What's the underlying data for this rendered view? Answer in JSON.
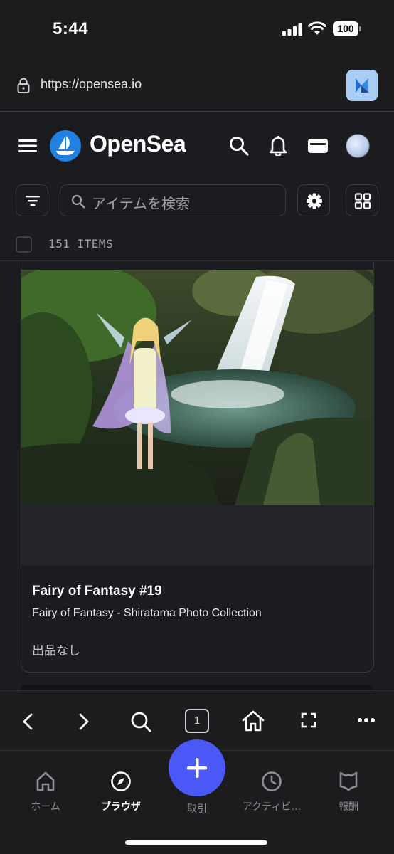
{
  "status_bar": {
    "time": "5:44",
    "battery": "100"
  },
  "browser": {
    "url": "https://opensea.io"
  },
  "opensea": {
    "logo_text": "OpenSea",
    "search_placeholder": "アイテムを検索",
    "items_count": "151 ITEMS"
  },
  "card": {
    "title": "Fairy of Fantasy #19",
    "collection": "Fairy of Fantasy - Shiratama Photo Collection",
    "status": "出品なし"
  },
  "browser_toolbar": {
    "tab_count": "1"
  },
  "tab_bar": {
    "tabs": [
      {
        "label": "ホーム",
        "icon": "home-icon"
      },
      {
        "label": "ブラウザ",
        "icon": "compass-icon",
        "active": true
      },
      {
        "label": "取引",
        "icon": "plus-icon"
      },
      {
        "label": "アクティビ…",
        "icon": "clock-icon"
      },
      {
        "label": "報酬",
        "icon": "reward-icon"
      }
    ]
  },
  "colors": {
    "accent": "#4a58f8",
    "opensea_blue": "#2081e2",
    "background": "#1b1c1f"
  }
}
